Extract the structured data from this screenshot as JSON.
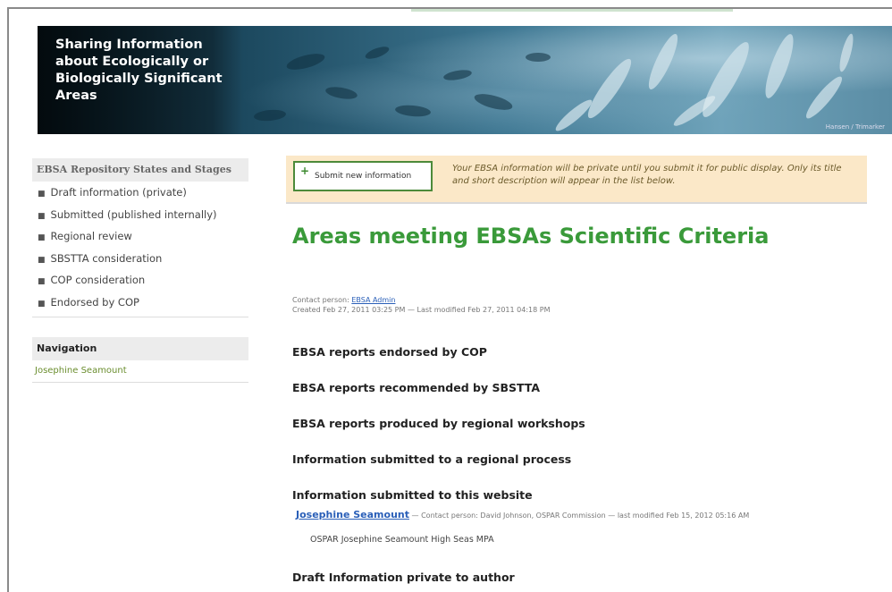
{
  "banner": {
    "title_lines": [
      "Sharing Information",
      "about Ecologically or",
      "Biologically Significant",
      "Areas"
    ],
    "credit": "Hansen / Trimarker"
  },
  "sidebar": {
    "states_header": "EBSA Repository States and Stages",
    "states": [
      "Draft information (private)",
      "Submitted (published internally)",
      "Regional review",
      "SBSTTA consideration",
      "COP consideration",
      "Endorsed by COP"
    ],
    "navigation_header": "Navigation",
    "navigation_items": [
      "Josephine Seamount"
    ]
  },
  "notice": {
    "button_label": "Submit new information",
    "text": "Your EBSA information will be private until you submit it for public display. Only its title and short description will appear in the list below."
  },
  "page": {
    "title": "Areas meeting EBSAs Scientific Criteria",
    "contact_label": "Contact person: ",
    "contact_name": "EBSA Admin",
    "created_line": "Created Feb 27, 2011 03:25 PM — Last modified Feb 27, 2011 04:18 PM"
  },
  "sections": [
    "EBSA reports endorsed by COP",
    "EBSA reports recommended by SBSTTA",
    "EBSA reports produced by regional workshops",
    "Information submitted to a regional process",
    "Information submitted to this website",
    "Draft Information private to author"
  ],
  "entry": {
    "title": "Josephine Seamount",
    "meta": " — Contact person: David Johnson, OSPAR Commission — last modified Feb 15, 2012 05:16 AM",
    "description": "OSPAR Josephine Seamount High Seas MPA"
  }
}
